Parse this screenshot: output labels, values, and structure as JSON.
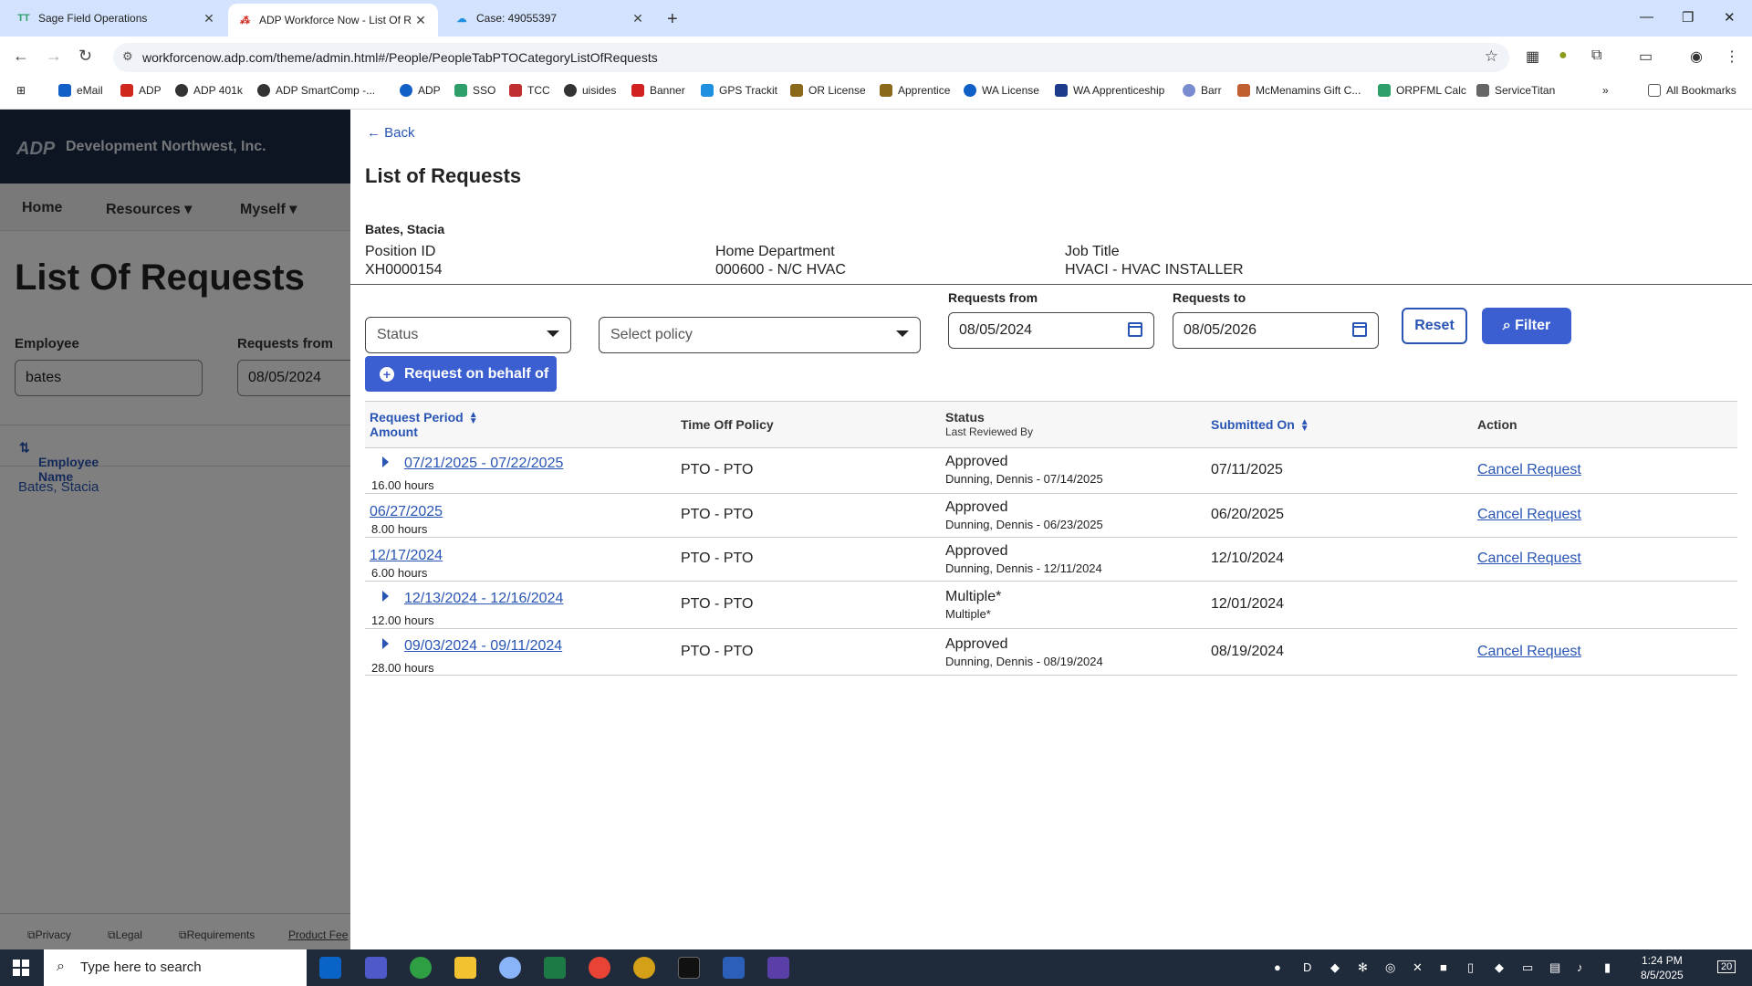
{
  "browser": {
    "tabs": [
      {
        "title": "Sage Field Operations",
        "icon": "TT"
      },
      {
        "title": "ADP Workforce Now - List Of R",
        "icon": "ADP"
      },
      {
        "title": "Case: 49055397",
        "icon": "cloud-icon"
      }
    ],
    "url": "workforcenow.adp.com/theme/admin.html#/People/PeopleTabPTOCategoryListOfRequests",
    "bookmarks": [
      "eMail",
      "ADP",
      "ADP 401k",
      "ADP SmartComp -...",
      "ADP",
      "SSO",
      "TCC",
      "uisides",
      "Banner",
      "GPS Trackit",
      "OR License",
      "Apprentice",
      "WA License",
      "WA Apprenticeship",
      "Barr",
      "McMenamins Gift C...",
      "ORPFML Calc",
      "ServiceTitan"
    ],
    "all_bookmarks": "All Bookmarks"
  },
  "background": {
    "logo": "ADP",
    "company": "Development Northwest, Inc.",
    "nav": [
      "Home",
      "Resources",
      "Myself"
    ],
    "title": "List Of Requests",
    "employee_label": "Employee",
    "employee_value": "bates",
    "requests_from_label": "Requests from",
    "requests_from_value": "08/05/2024",
    "col_employee_name": "Employee Name",
    "row_name": "Bates, Stacia",
    "footer": [
      "Privacy",
      "Legal",
      "Requirements",
      "Product Fee"
    ]
  },
  "panel": {
    "back": "Back",
    "title": "List of Requests",
    "employee_name": "Bates, Stacia",
    "position_id_label": "Position ID",
    "position_id": "XH0000154",
    "home_dept_label": "Home Department",
    "home_dept": "000600 - N/C HVAC",
    "job_title_label": "Job Title",
    "job_title": "HVACI - HVAC INSTALLER",
    "status_placeholder": "Status",
    "policy_placeholder": "Select policy",
    "requests_from_label": "Requests from",
    "requests_from": "08/05/2024",
    "requests_to_label": "Requests to",
    "requests_to": "08/05/2026",
    "reset": "Reset",
    "filter": "Filter",
    "request_behalf": "Request on behalf of"
  },
  "table": {
    "headers": {
      "period": "Request Period",
      "amount": "Amount",
      "policy": "Time Off Policy",
      "status": "Status",
      "last_reviewed": "Last Reviewed By",
      "submitted": "Submitted On",
      "action": "Action"
    },
    "rows": [
      {
        "period": "07/21/2025 - 07/22/2025",
        "amount": "16.00 hours",
        "policy": "PTO - PTO",
        "status": "Approved",
        "reviewed": "Dunning, Dennis - 07/14/2025",
        "submitted": "07/11/2025",
        "action": "Cancel Request"
      },
      {
        "period": "06/27/2025",
        "amount": "8.00 hours",
        "policy": "PTO - PTO",
        "status": "Approved",
        "reviewed": "Dunning, Dennis - 06/23/2025",
        "submitted": "06/20/2025",
        "action": "Cancel Request"
      },
      {
        "period": "12/17/2024",
        "amount": "6.00 hours",
        "policy": "PTO - PTO",
        "status": "Approved",
        "reviewed": "Dunning, Dennis - 12/11/2024",
        "submitted": "12/10/2024",
        "action": "Cancel Request"
      },
      {
        "period": "12/13/2024 - 12/16/2024",
        "amount": "12.00 hours",
        "policy": "PTO - PTO",
        "status": "Multiple*",
        "reviewed": "Multiple*",
        "submitted": "12/01/2024",
        "action": ""
      },
      {
        "period": "09/03/2024 - 09/11/2024",
        "amount": "28.00 hours",
        "policy": "PTO - PTO",
        "status": "Approved",
        "reviewed": "Dunning, Dennis - 08/19/2024",
        "submitted": "08/19/2024",
        "action": "Cancel Request"
      }
    ]
  },
  "taskbar": {
    "search_placeholder": "Type here to search",
    "time": "1:24 PM",
    "date": "8/5/2025",
    "notifications": "20"
  },
  "colors": {
    "accent": "#3b5fd0",
    "link": "#2955b4",
    "header": "#1a2b47"
  }
}
